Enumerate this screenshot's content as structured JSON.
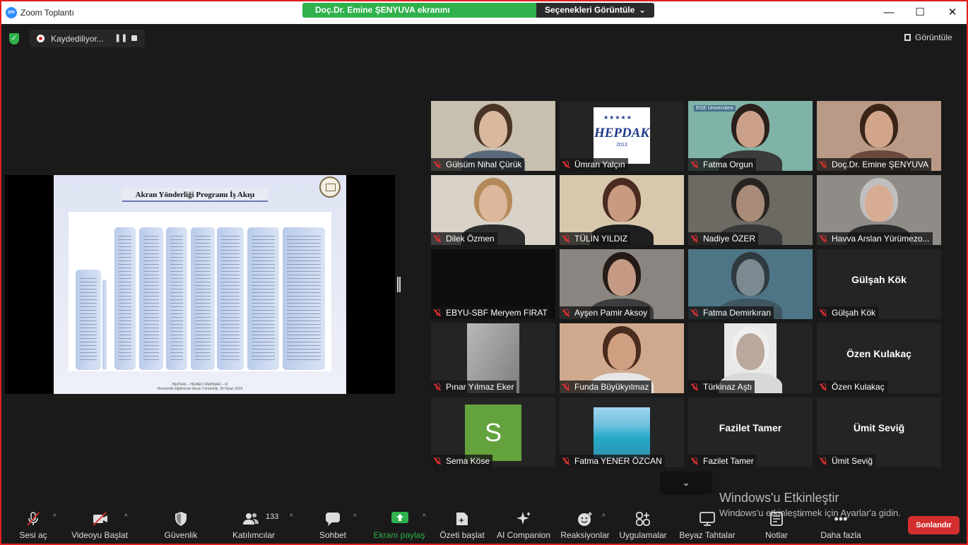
{
  "window": {
    "title": "Zoom Toplantı",
    "logo_text": "zm"
  },
  "share_banner": {
    "message": "Doç.Dr. Emine ŞENYUVA ekranını görüntülüyorsunuz",
    "options": "Seçenekleri Görüntüle",
    "options_icon": "chevron-down-icon"
  },
  "window_controls": {
    "minimize": "—",
    "maximize": "☐",
    "close": "✕"
  },
  "recording": {
    "label": "Kaydediliyor...",
    "pause": "❚❚"
  },
  "view_button": "Görüntüle",
  "slide": {
    "title": "Akran Yönderliği Programı İş Akışı",
    "footer_line1": "HEPDAK – HEMED WEBINAR – XI",
    "footer_line2": "Hemşirelik Eğitiminde Akran Yönderliği, 30 Nisan 2024"
  },
  "participants": [
    {
      "name": "Gülsüm Nihal Çürük",
      "kind": "video",
      "skin": "#d9b8a0",
      "bg": "#c7bfb0",
      "hair": "#4a3426",
      "shirt": "#5b6a7a"
    },
    {
      "name": "Ümran Yalçın",
      "kind": "logo",
      "logo": "HEPDAK",
      "logo_sub": "2013"
    },
    {
      "name": "Fatma Orgun",
      "kind": "video",
      "skin": "#caa08a",
      "bg": "#7fb3a8",
      "hair": "#2a1f1a",
      "shirt": "#3b3b3b",
      "logo": "EGE Üniversitesi"
    },
    {
      "name": "Doç.Dr. Emine ŞENYUVA",
      "kind": "video",
      "active": true,
      "skin": "#d2a58b",
      "bg": "#b89a86",
      "hair": "#3a2418",
      "shirt": "#6a4a3c"
    },
    {
      "name": "Dilek Özmen",
      "kind": "video",
      "skin": "#dcb79b",
      "bg": "#d8d2c8",
      "hair": "#b58a5a",
      "shirt": "#2d2d2d"
    },
    {
      "name": "TÜLİN YILDIZ",
      "kind": "video",
      "skin": "#c89a80",
      "bg": "#d7c7ad",
      "hair": "#4b2a20",
      "shirt": "#1f1f1f"
    },
    {
      "name": "Nadiye ÖZER",
      "kind": "video",
      "skin": "#a88a78",
      "bg": "#6c6a63",
      "hair": "#2a2420",
      "shirt": "#3a3a3a"
    },
    {
      "name": "Havva Arslan Yürümezo...",
      "kind": "video",
      "skin": "#d6ad93",
      "bg": "#8f8b86",
      "hair": "#bfbfbf",
      "shirt": "#2c2c2c"
    },
    {
      "name": "EBYU-SBF Meryem FIRAT",
      "kind": "dark"
    },
    {
      "name": "Ayşen Pamir Aksoy",
      "kind": "video",
      "skin": "#c49a84",
      "bg": "#8a8580",
      "hair": "#241a16",
      "shirt": "#3d3d3d"
    },
    {
      "name": "Fatma Demirkıran",
      "kind": "video",
      "skin": "#7a8a90",
      "bg": "#4e7586",
      "hair": "#2e3a3e",
      "shirt": "#3f5660"
    },
    {
      "name": "Gülşah Kök",
      "kind": "name"
    },
    {
      "name": "Pınar Yılmaz Eker",
      "kind": "room",
      "bg": "#9a9a9a"
    },
    {
      "name": "Funda Büyükyılmaz",
      "kind": "video",
      "skin": "#d09e80",
      "bg": "#cfa98e",
      "hair": "#4a2c1e",
      "shirt": "#e6e6e6"
    },
    {
      "name": "Türkinaz Aştı",
      "kind": "portrait",
      "skin": "#b9a89c",
      "bg": "#e8e8e6",
      "hair": "#efefef",
      "shirt": "#d8d8d8"
    },
    {
      "name": "Özen Kulakaç",
      "kind": "name"
    },
    {
      "name": "Sema Köse",
      "kind": "avatar",
      "initial": "S"
    },
    {
      "name": "Fatma YENER ÖZCAN",
      "kind": "beach"
    },
    {
      "name": "Fazilet Tamer",
      "kind": "name"
    },
    {
      "name": "Ümit Seviğ",
      "kind": "name"
    }
  ],
  "collapse_icon": "⌄",
  "windows_activation": {
    "title": "Windows'u Etkinleştir",
    "subtitle": "Windows'u etkinleştirmek için Ayarlar'a gidin."
  },
  "toolbar": {
    "mute": {
      "label": "Sesi aç",
      "icon": "mic-off-icon"
    },
    "video": {
      "label": "Videoyu Başlat",
      "icon": "video-off-icon"
    },
    "security": {
      "label": "Güvenlik",
      "icon": "shield-icon"
    },
    "participants": {
      "label": "Katılımcılar",
      "count": "133",
      "icon": "people-icon"
    },
    "chat": {
      "label": "Sohbet",
      "icon": "chat-icon"
    },
    "share": {
      "label": "Ekranı paylaş",
      "icon": "share-up-arrow-icon",
      "color": "#2fb24c"
    },
    "summary": {
      "label": "Özeti başlat",
      "icon": "summary-icon"
    },
    "ai": {
      "label": "AI Companion",
      "icon": "sparkle-icon"
    },
    "reactions": {
      "label": "Reaksiyonlar",
      "icon": "smiley-icon"
    },
    "apps": {
      "label": "Uygulamalar",
      "icon": "apps-icon"
    },
    "whiteboard": {
      "label": "Beyaz Tahtalar",
      "icon": "whiteboard-icon"
    },
    "notes": {
      "label": "Notlar",
      "icon": "notes-icon"
    },
    "more": {
      "label": "Daha fazla",
      "icon": "more-dots-icon"
    },
    "end": {
      "label": "Sonlandır",
      "color": "#d32f2f"
    }
  }
}
